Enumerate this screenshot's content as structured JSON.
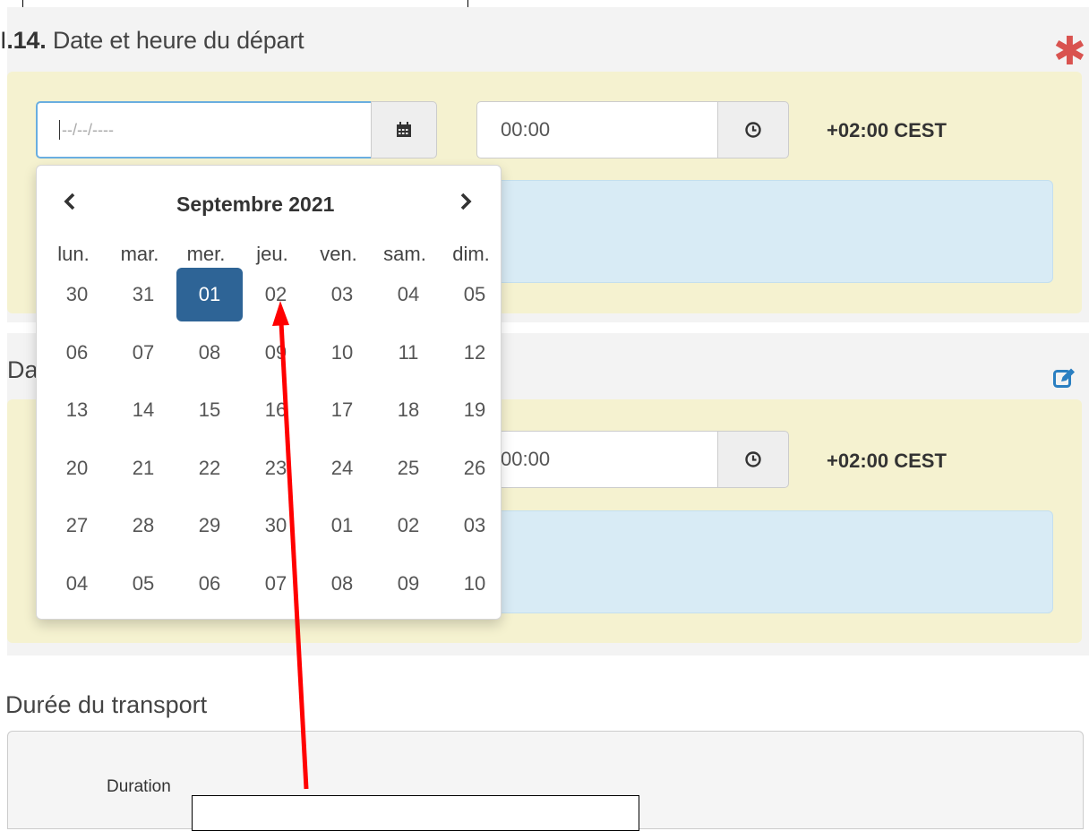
{
  "section1": {
    "number": ".14.",
    "title": " Date et heure du départ",
    "required_marker": "✱"
  },
  "departure": {
    "date_placeholder": "--/--/----",
    "date_icon": "calendar-icon",
    "time_value": "00:00",
    "time_icon": "clock-icon",
    "timezone": "+02:00 CEST"
  },
  "section2": {
    "title_fragment": "Da",
    "edit_icon": "edit-icon"
  },
  "arrival": {
    "time_value": "00:00",
    "time_icon": "clock-icon",
    "timezone": "+02:00 CEST"
  },
  "datepicker": {
    "prev_icon": "chevron-left-icon",
    "next_icon": "chevron-right-icon",
    "month_year": "Septembre 2021",
    "weekdays": [
      "lun.",
      "mar.",
      "mer.",
      "jeu.",
      "ven.",
      "sam.",
      "dim."
    ],
    "weeks": [
      [
        "30",
        "31",
        "01",
        "02",
        "03",
        "04",
        "05"
      ],
      [
        "06",
        "07",
        "08",
        "09",
        "10",
        "11",
        "12"
      ],
      [
        "13",
        "14",
        "15",
        "16",
        "17",
        "18",
        "19"
      ],
      [
        "20",
        "21",
        "22",
        "23",
        "24",
        "25",
        "26"
      ],
      [
        "27",
        "28",
        "29",
        "30",
        "01",
        "02",
        "03"
      ],
      [
        "04",
        "05",
        "06",
        "07",
        "08",
        "09",
        "10"
      ]
    ],
    "selected_day": "01"
  },
  "section3": {
    "title": "Durée du transport",
    "duration_label": "Duration"
  },
  "colors": {
    "accent": "#2e6496",
    "required": "#d9534f",
    "annotation": "#ff0000",
    "edit_icon": "#2a7fc1"
  }
}
